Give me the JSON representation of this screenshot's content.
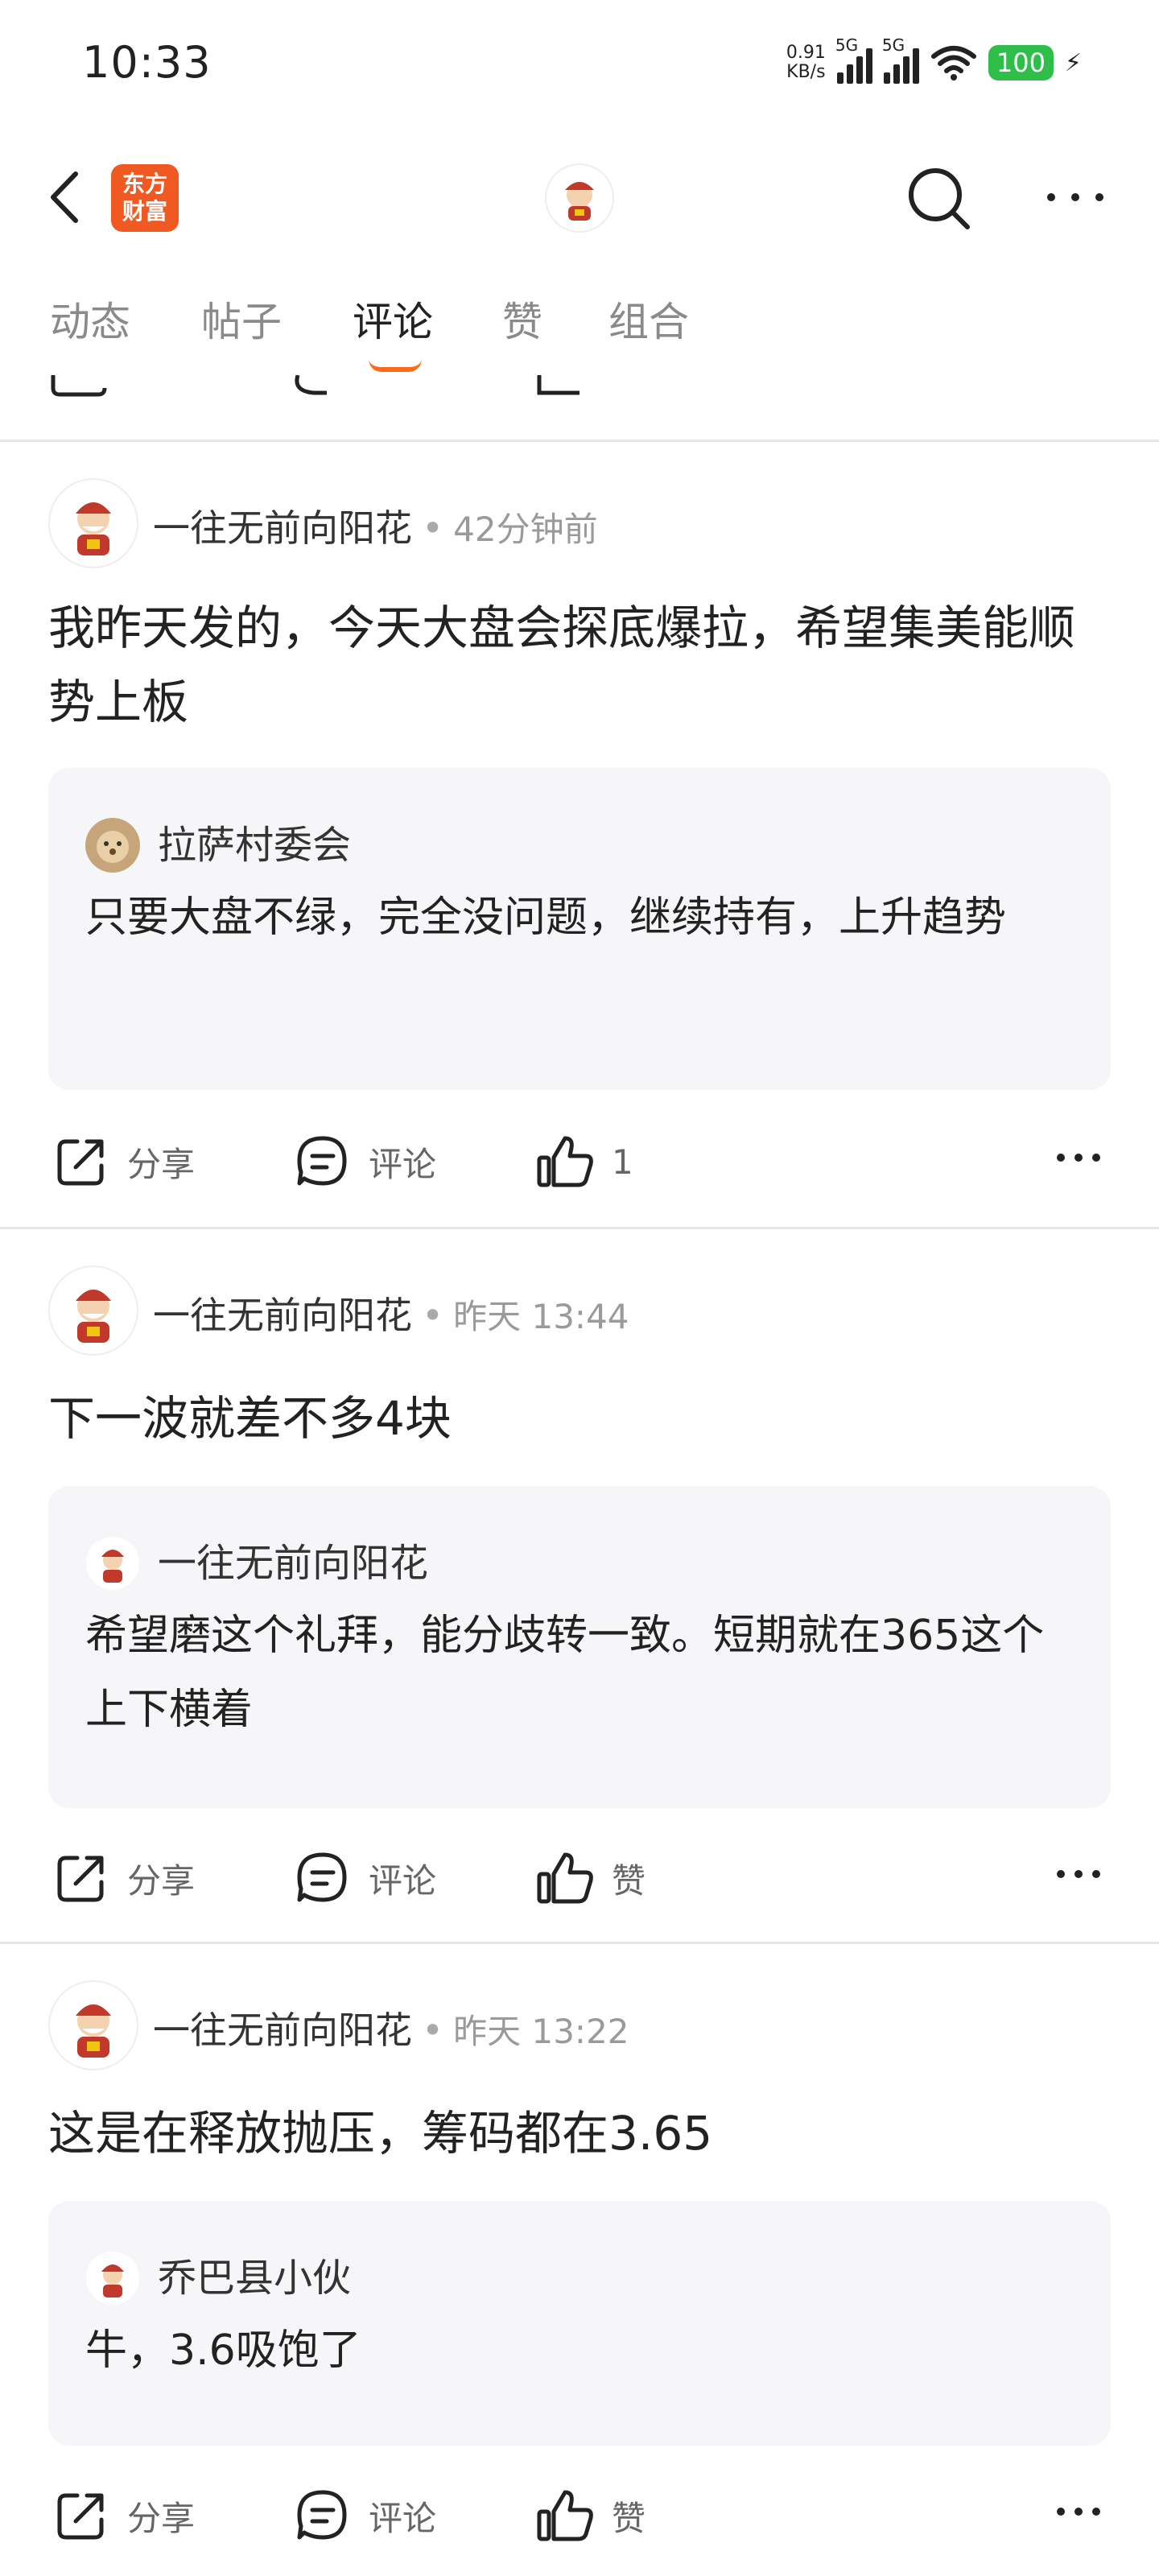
{
  "status_bar": {
    "time": "10:33",
    "net_speed_value": "0.91",
    "net_speed_unit": "KB/s",
    "signal_1_label": "5G",
    "signal_2_label": "5G",
    "battery": "100"
  },
  "nav": {
    "logo_line1": "东方",
    "logo_line2": "财富"
  },
  "tabs": [
    "动态",
    "帖子",
    "评论",
    "赞",
    "组合"
  ],
  "active_tab": "评论",
  "posts": [
    {
      "author": "一往无前向阳花",
      "time": "42分钟前",
      "content": "我昨天发的，今天大盘会探底爆拉，希望集美能顺势上板",
      "quote_author": "拉萨村委会",
      "quote_text": "只要大盘不绿，完全没问题，继续持有，上升趋势",
      "share": "分享",
      "comment": "评论",
      "like": "1"
    },
    {
      "author": "一往无前向阳花",
      "time": "昨天 13:44",
      "content": "下一波就差不多4块",
      "quote_author": "一往无前向阳花",
      "quote_text": "希望磨这个礼拜，能分歧转一致。短期就在365这个上下横着",
      "share": "分享",
      "comment": "评论",
      "like": "赞"
    },
    {
      "author": "一往无前向阳花",
      "time": "昨天 13:22",
      "content": "这是在释放抛压，筹码都在3.65",
      "quote_author": "乔巴县小伙",
      "quote_text": "牛，3.6吸饱了",
      "share": "分享",
      "comment": "评论",
      "like": "赞"
    }
  ],
  "icons": {
    "back": "chevron-left-icon",
    "search": "search-icon",
    "more": "more-horizontal-icon",
    "share": "share-icon",
    "comment": "comment-icon",
    "like": "thumbs-up-icon"
  },
  "colors": {
    "accent": "#ff6a1a",
    "logo": "#f05a22",
    "battery": "#2fbe4a",
    "quote_bg": "#f6f6f8"
  }
}
